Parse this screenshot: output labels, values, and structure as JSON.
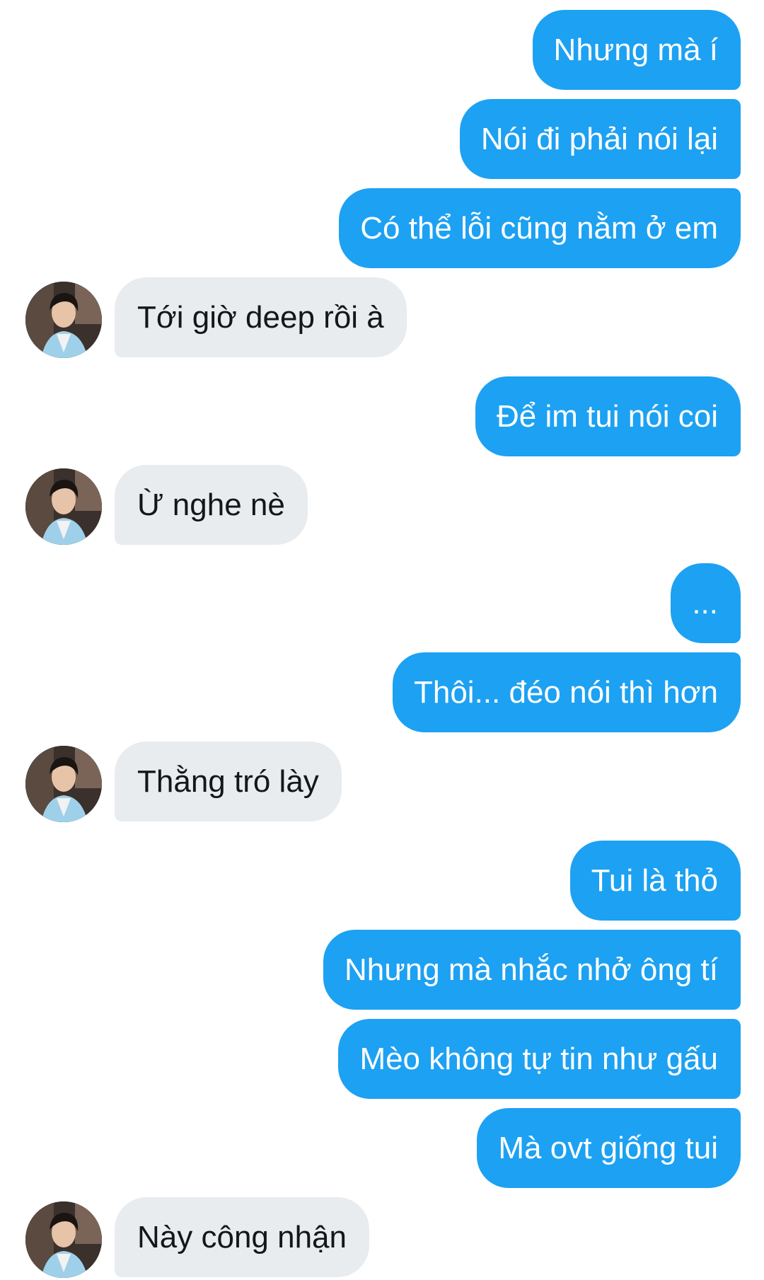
{
  "conversation": {
    "messages": [
      {
        "sender": "me",
        "text": "Nhưng mà í"
      },
      {
        "sender": "me",
        "text": "Nói đi phải nói lại"
      },
      {
        "sender": "me",
        "text": "Có thể lỗi cũng nằm ở em"
      },
      {
        "sender": "them",
        "text": "Tới giờ deep rồi à"
      },
      {
        "sender": "me",
        "text": "Để im tui nói coi"
      },
      {
        "sender": "them",
        "text": "Ừ nghe nè"
      },
      {
        "sender": "me",
        "text": "..."
      },
      {
        "sender": "me",
        "text": "Thôi... đéo nói thì hơn"
      },
      {
        "sender": "them",
        "text": "Thằng tró lày"
      },
      {
        "sender": "me",
        "text": "Tui là thỏ"
      },
      {
        "sender": "me",
        "text": "Nhưng mà nhắc nhở ông tí"
      },
      {
        "sender": "me",
        "text": "Mèo không tự tin như gấu"
      },
      {
        "sender": "me",
        "text": "Mà ovt giống tui"
      },
      {
        "sender": "them",
        "text": "Này công nhận"
      }
    ]
  },
  "colors": {
    "outgoing_bubble": "#1da1f2",
    "incoming_bubble": "#e8ecef",
    "background": "#ffffff"
  }
}
